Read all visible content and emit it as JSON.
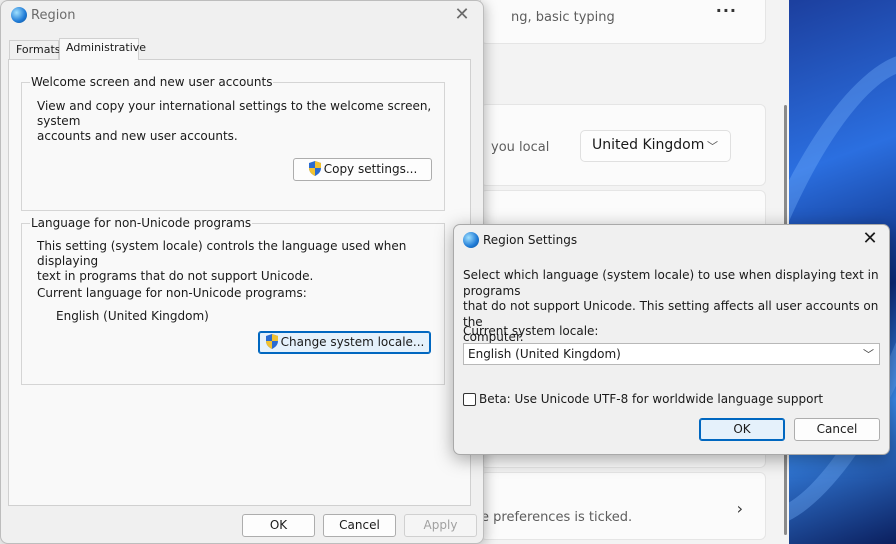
{
  "settings_bg": {
    "card1_text": "ng, basic typing",
    "card2_text": "you local",
    "country_value": "United Kingdom",
    "card5_text": "e preferences is ticked.",
    "more_glyph": "···",
    "chevron_glyph": "›"
  },
  "region": {
    "title": "Region",
    "tabs": [
      "Formats",
      "Administrative"
    ],
    "welcome_group": {
      "title": "Welcome screen and new user accounts",
      "desc_line1": "View and copy your international settings to the welcome screen, system",
      "desc_line2": "accounts and new user accounts.",
      "copy_button": "Copy settings..."
    },
    "unicode_group": {
      "title": "Language for non-Unicode programs",
      "desc_line1": "This setting (system locale) controls the language used when displaying",
      "desc_line2": "text in programs that do not support Unicode.",
      "current_label": "Current language for non-Unicode programs:",
      "current_value": "English (United Kingdom)",
      "change_button": "Change system locale..."
    },
    "buttons": {
      "ok": "OK",
      "cancel": "Cancel",
      "apply": "Apply"
    }
  },
  "region_settings": {
    "title": "Region Settings",
    "desc_line1": "Select which language (system locale) to use when displaying text in programs",
    "desc_line2": "that do not support Unicode. This setting affects all user accounts on the",
    "desc_line3": "computer.",
    "locale_label": "Current system locale:",
    "locale_value": "English (United Kingdom)",
    "beta_label": "Beta: Use Unicode UTF-8 for worldwide language support",
    "beta_checked": false,
    "buttons": {
      "ok": "OK",
      "cancel": "Cancel"
    }
  }
}
